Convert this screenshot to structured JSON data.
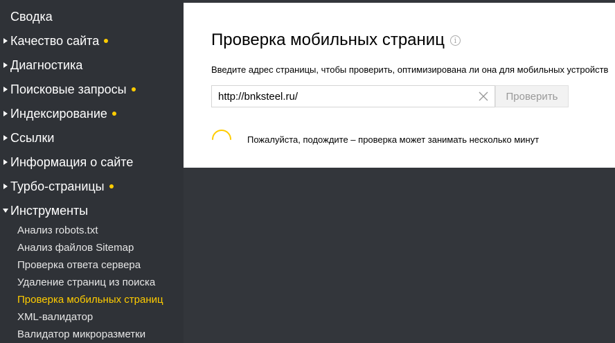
{
  "sidebar": {
    "items": [
      {
        "label": "Сводка",
        "has_arrow": false,
        "badge": false
      },
      {
        "label": "Качество сайта",
        "has_arrow": true,
        "badge": true
      },
      {
        "label": "Диагностика",
        "has_arrow": true,
        "badge": false
      },
      {
        "label": "Поисковые запросы",
        "has_arrow": true,
        "badge": true
      },
      {
        "label": "Индексирование",
        "has_arrow": true,
        "badge": true
      },
      {
        "label": "Ссылки",
        "has_arrow": true,
        "badge": false
      },
      {
        "label": "Информация о сайте",
        "has_arrow": true,
        "badge": false
      },
      {
        "label": "Турбо-страницы",
        "has_arrow": true,
        "badge": true
      },
      {
        "label": "Инструменты",
        "has_arrow": true,
        "expanded": true,
        "badge": false
      }
    ],
    "tools_subitems": [
      {
        "label": "Анализ robots.txt",
        "active": false
      },
      {
        "label": "Анализ файлов Sitemap",
        "active": false
      },
      {
        "label": "Проверка ответа сервера",
        "active": false
      },
      {
        "label": "Удаление страниц из поиска",
        "active": false
      },
      {
        "label": "Проверка мобильных страниц",
        "active": true
      },
      {
        "label": "XML-валидатор",
        "active": false
      },
      {
        "label": "Валидатор микроразметки",
        "active": false
      }
    ]
  },
  "main": {
    "title": "Проверка мобильных страниц",
    "info_icon": "info-icon",
    "description": "Введите адрес страницы, чтобы проверить, оптимизирована ли она для мобильных устройств",
    "url_input": {
      "value": "http://bnksteel.ru/",
      "placeholder": ""
    },
    "check_button_label": "Проверить",
    "wait_message": "Пожалуйста, подождите – проверка может занимать несколько минут"
  },
  "colors": {
    "sidebar_bg": "#2f3237",
    "accent": "#ffcc00",
    "panel_bg": "#ffffff",
    "page_bg": "#33363b"
  }
}
